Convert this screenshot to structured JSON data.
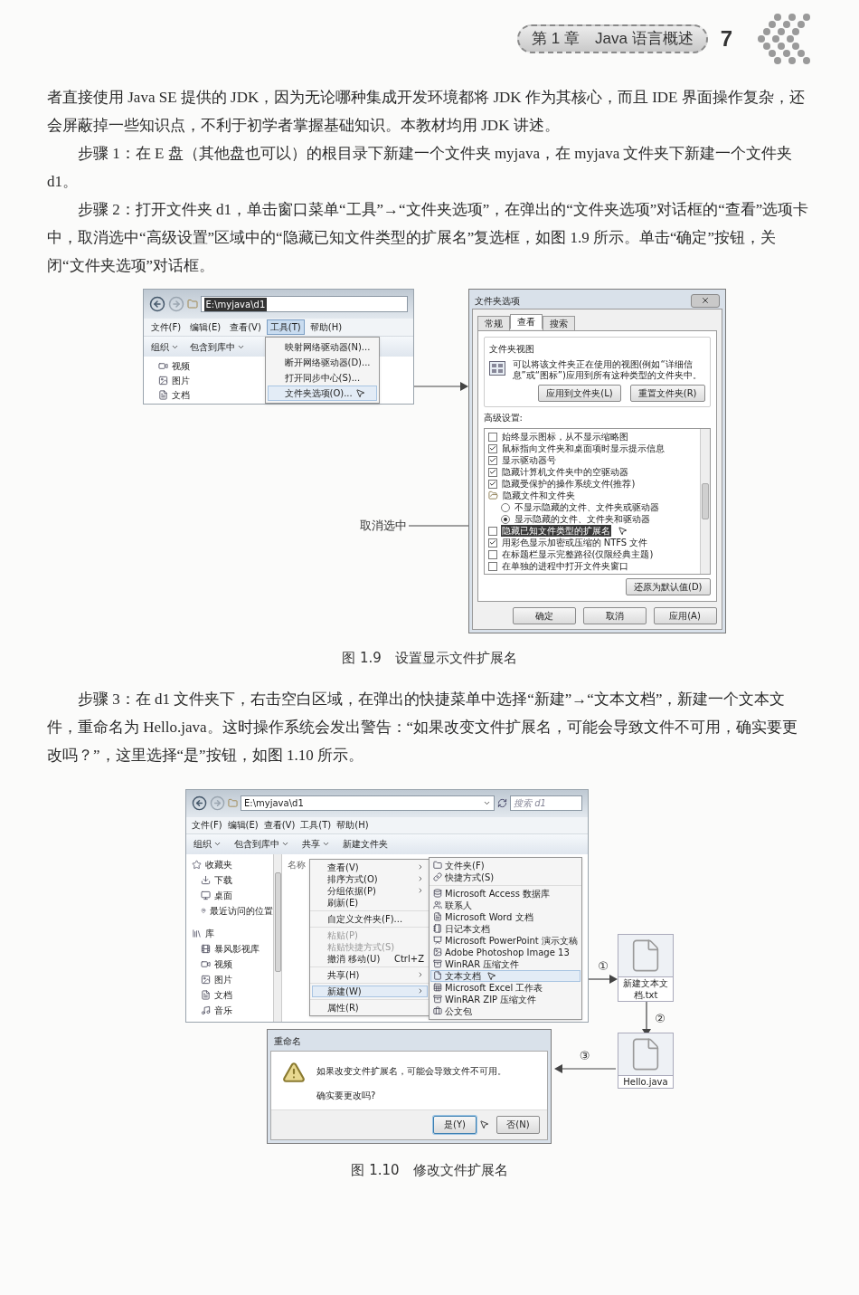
{
  "header": {
    "chapter": "第 1 章　Java 语言概述",
    "page": "7"
  },
  "paragraphs_top": [
    {
      "indent": false,
      "text": "者直接使用 Java SE 提供的 JDK，因为无论哪种集成开发环境都将 JDK 作为其核心，而且 IDE 界面操作复杂，还会屏蔽掉一些知识点，不利于初学者掌握基础知识。本教材均用 JDK 讲述。"
    },
    {
      "indent": true,
      "text": "步骤 1：在 E 盘（其他盘也可以）的根目录下新建一个文件夹 myjava，在 myjava 文件夹下新建一个文件夹 d1。"
    },
    {
      "indent": true,
      "text": "步骤 2：打开文件夹 d1，单击窗口菜单“工具”→“文件夹选项”，在弹出的“文件夹选项”对话框的“查看”选项卡中，取消选中“高级设置”区域中的“隐藏已知文件类型的扩展名”复选框，如图 1.9 所示。单击“确定”按钮，关闭“文件夹选项”对话框。"
    }
  ],
  "figure_1": {
    "explorer": {
      "address": "E:\\myjava\\d1",
      "menu_bar": [
        {
          "label": "文件(F)",
          "selected": false
        },
        {
          "label": "编辑(E)",
          "selected": false
        },
        {
          "label": "查看(V)",
          "selected": false
        },
        {
          "label": "工具(T)",
          "selected": true
        },
        {
          "label": "帮助(H)",
          "selected": false
        }
      ],
      "toolbar": [
        {
          "label": "组织",
          "dropdown": true
        },
        {
          "label": "包含到库中",
          "dropdown": true
        }
      ],
      "sidebar": [
        "视频",
        "图片",
        "文档"
      ],
      "tools_menu": [
        {
          "label": "映射网络驱动器(N)...",
          "selected": false
        },
        {
          "label": "断开网络驱动器(D)...",
          "selected": false
        },
        {
          "label": "打开同步中心(S)...",
          "selected": false
        },
        {
          "label": "文件夹选项(O)...",
          "selected": true
        }
      ]
    },
    "dialog": {
      "title": "文件夹选项",
      "tabs": [
        {
          "label": "常规",
          "selected": false
        },
        {
          "label": "查看",
          "selected": true
        },
        {
          "label": "搜索",
          "selected": false
        }
      ],
      "group_title": "文件夹视图",
      "description": "可以将该文件夹正在使用的视图(例如“详细信息”或“图标”)应用到所有这种类型的文件夹中。",
      "group_buttons": [
        "应用到文件夹(L)",
        "重置文件夹(R)"
      ],
      "advanced_label": "高级设置:",
      "settings": [
        {
          "kind": "checkbox",
          "label": "始终显示图标，从不显示缩略图",
          "checked": false,
          "selected": false
        },
        {
          "kind": "checkbox",
          "label": "鼠标指向文件夹和桌面项时显示提示信息",
          "checked": true,
          "selected": false
        },
        {
          "kind": "checkbox",
          "label": "显示驱动器号",
          "checked": true,
          "selected": false
        },
        {
          "kind": "checkbox",
          "label": "隐藏计算机文件夹中的空驱动器",
          "checked": true,
          "selected": false
        },
        {
          "kind": "checkbox",
          "label": "隐藏受保护的操作系统文件(推荐)",
          "checked": true,
          "selected": false
        },
        {
          "kind": "group",
          "label": "隐藏文件和文件夹",
          "selected": false
        },
        {
          "kind": "radio",
          "label": "不显示隐藏的文件、文件夹或驱动器",
          "checked": false,
          "selected": false
        },
        {
          "kind": "radio",
          "label": "显示隐藏的文件、文件夹和驱动器",
          "checked": true,
          "selected": false
        },
        {
          "kind": "checkbox",
          "label": "隐藏已知文件类型的扩展名",
          "checked": false,
          "selected": true
        },
        {
          "kind": "checkbox",
          "label": "用彩色显示加密或压缩的 NTFS 文件",
          "checked": true,
          "selected": false
        },
        {
          "kind": "checkbox",
          "label": "在标题栏显示完整路径(仅限经典主题)",
          "checked": false,
          "selected": false
        },
        {
          "kind": "checkbox",
          "label": "在单独的进程中打开文件夹窗口",
          "checked": false,
          "selected": false
        }
      ],
      "restore_button": "还原为默认值(D)",
      "buttons": [
        "确定",
        "取消",
        "应用(A)"
      ]
    },
    "callout": "取消选中",
    "caption": "图 1.9　设置显示文件扩展名"
  },
  "paragraphs_bottom": [
    {
      "indent": true,
      "text": "步骤 3：在 d1 文件夹下，右击空白区域，在弹出的快捷菜单中选择“新建”→“文本文档”，新建一个文本文件，重命名为 Hello.java。这时操作系统会发出警告：“如果改变文件扩展名，可能会导致文件不可用，确实要更改吗？”，这里选择“是”按钮，如图 1.10 所示。"
    }
  ],
  "figure_2": {
    "explorer": {
      "address": "E:\\myjava\\d1",
      "search_placeholder": "搜索 d1",
      "menu_bar": [
        "文件(F)",
        "编辑(E)",
        "查看(V)",
        "工具(T)",
        "帮助(H)"
      ],
      "toolbar": [
        {
          "label": "组织",
          "dropdown": true
        },
        {
          "label": "包含到库中",
          "dropdown": true
        },
        {
          "label": "共享",
          "dropdown": true
        },
        {
          "label": "新建文件夹",
          "dropdown": false
        }
      ],
      "sidebar": [
        {
          "label": "收藏夹",
          "children": [
            {
              "label": "下载"
            },
            {
              "label": "桌面"
            },
            {
              "label": "最近访问的位置"
            }
          ]
        },
        {
          "label": "库",
          "children": [
            {
              "label": "暴风影视库"
            },
            {
              "label": "视频"
            },
            {
              "label": "图片"
            },
            {
              "label": "文档"
            },
            {
              "label": "音乐"
            }
          ]
        }
      ],
      "column_header": "名称",
      "context_menu": [
        {
          "items": [
            {
              "label": "查看(V)",
              "submenu": true,
              "disabled": false,
              "selected": false
            },
            {
              "label": "排序方式(O)",
              "submenu": true,
              "disabled": false,
              "selected": false
            },
            {
              "label": "分组依据(P)",
              "submenu": true,
              "disabled": false,
              "selected": false
            },
            {
              "label": "刷新(E)",
              "submenu": false,
              "disabled": false,
              "selected": false
            }
          ]
        },
        {
          "items": [
            {
              "label": "自定义文件夹(F)...",
              "submenu": false,
              "disabled": false,
              "selected": false
            }
          ]
        },
        {
          "items": [
            {
              "label": "粘贴(P)",
              "submenu": false,
              "disabled": true,
              "selected": false
            },
            {
              "label": "粘贴快捷方式(S)",
              "submenu": false,
              "disabled": true,
              "selected": false
            },
            {
              "label": "撤消 移动(U)",
              "shortcut": "Ctrl+Z",
              "submenu": false,
              "disabled": false,
              "selected": false
            }
          ]
        },
        {
          "items": [
            {
              "label": "共享(H)",
              "submenu": true,
              "disabled": false,
              "selected": false
            }
          ]
        },
        {
          "items": [
            {
              "label": "新建(W)",
              "submenu": true,
              "disabled": false,
              "selected": true
            }
          ]
        },
        {
          "items": [
            {
              "label": "属性(R)",
              "submenu": false,
              "disabled": false,
              "selected": false
            }
          ]
        }
      ],
      "new_menu": [
        {
          "items": [
            {
              "label": "文件夹(F)",
              "selected": false
            },
            {
              "label": "快捷方式(S)",
              "selected": false
            }
          ]
        },
        {
          "items": [
            {
              "label": "Microsoft Access 数据库",
              "selected": false
            },
            {
              "label": "联系人",
              "selected": false
            },
            {
              "label": "Microsoft Word 文档",
              "selected": false
            },
            {
              "label": "日记本文档",
              "selected": false
            },
            {
              "label": "Microsoft PowerPoint 演示文稿",
              "selected": false
            },
            {
              "label": "Adobe Photoshop Image 13",
              "selected": false
            },
            {
              "label": "WinRAR 压缩文件",
              "selected": false
            },
            {
              "label": "文本文档",
              "selected": true
            },
            {
              "label": "Microsoft Excel 工作表",
              "selected": false
            },
            {
              "label": "WinRAR ZIP 压缩文件",
              "selected": false
            },
            {
              "label": "公文包",
              "selected": false
            }
          ]
        }
      ]
    },
    "new_file": "新建文本文档.txt",
    "renamed_file": "Hello.java",
    "steps": [
      "①",
      "②",
      "③"
    ],
    "rename_dialog": {
      "title": "重命名",
      "message": "如果改变文件扩展名，可能会导致文件不可用。",
      "question": "确实要更改吗?",
      "buttons": [
        {
          "label": "是(Y)",
          "selected": true
        },
        {
          "label": "否(N)",
          "selected": false
        }
      ]
    },
    "caption": "图 1.10　修改文件扩展名"
  }
}
